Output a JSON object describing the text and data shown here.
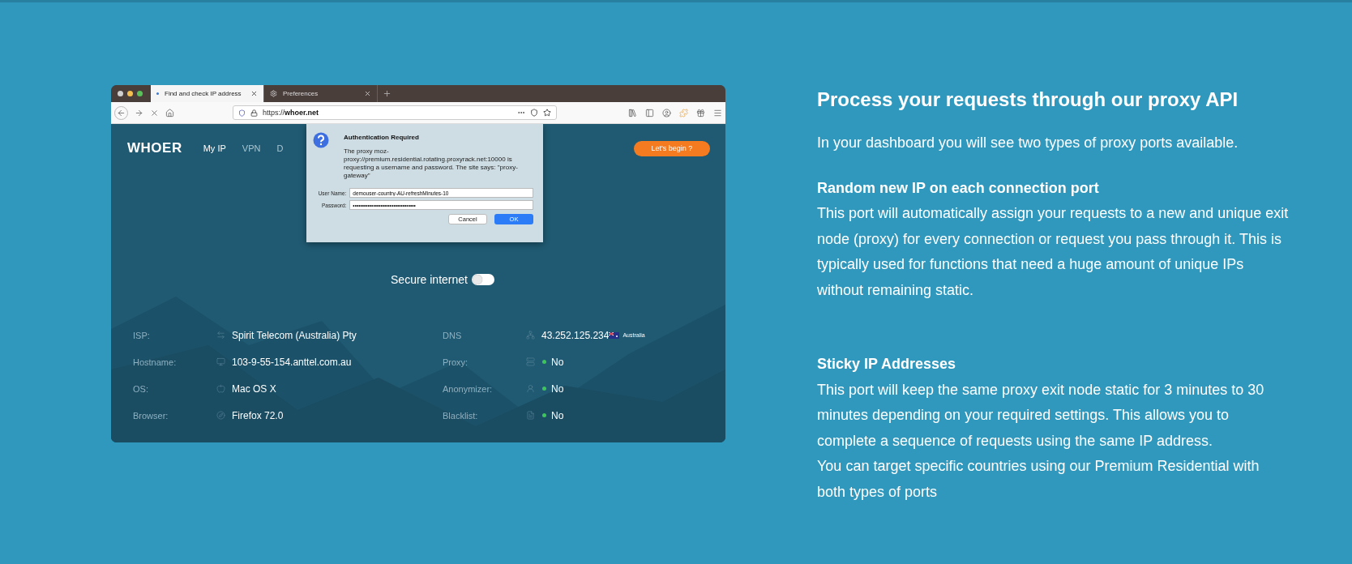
{
  "browser": {
    "tabs": [
      {
        "label": "Find and check IP address",
        "selected": true,
        "kind": "page"
      },
      {
        "label": "Preferences",
        "selected": false,
        "kind": "settings"
      }
    ],
    "address": "https://**whoer.net**",
    "site": {
      "logo": "WHOER",
      "nav": [
        {
          "label": "My IP",
          "selected": true
        },
        {
          "label": "VPN",
          "selected": false
        },
        {
          "label": "D",
          "selected": false
        }
      ],
      "cta": "Let's begin ?",
      "toggle": {
        "label": "Secure internet",
        "on": false
      },
      "info_left": [
        {
          "label": "ISP:",
          "value": "Spirit Telecom (Australia) Pty",
          "kind": "isp"
        },
        {
          "label": "Hostname:",
          "value": "103-9-55-154.anttel.com.au",
          "kind": "host"
        },
        {
          "label": "OS:",
          "value": "Mac OS X",
          "kind": "os"
        },
        {
          "label": "Browser:",
          "value": "Firefox 72.0",
          "kind": "browser"
        }
      ],
      "info_right": [
        {
          "label": "DNS",
          "value": "43.252.125.234",
          "kind": "dns",
          "country": "Australia"
        },
        {
          "label": "Proxy:",
          "value": "No",
          "kind": "proxy",
          "color": "#3fc35c"
        },
        {
          "label": "Anonymizer:",
          "value": "No",
          "kind": "anon",
          "color": "#3fc35c"
        },
        {
          "label": "Blacklist:",
          "value": "No",
          "kind": "blacklist",
          "color": "#3fc35c"
        }
      ]
    },
    "dialog": {
      "title": "Authentication Required",
      "message": "The proxy moz-proxy://premium.residential.rotating.proxyrack.net:10000 is requesting a username and password. The site says: \"proxy-gateway\"",
      "fields": [
        {
          "label": "User Name:",
          "value": "demouser-country-AU-refreshMinutes-10"
        },
        {
          "label": "Password:",
          "value": "••••••••••••••••••••••••••••••••••"
        }
      ],
      "buttons": [
        {
          "label": "Cancel",
          "primary": false
        },
        {
          "label": "OK",
          "primary": true
        }
      ]
    }
  },
  "article": {
    "heading": "Process your requests through our proxy API",
    "intro": "In your dashboard you will see two types of proxy ports available.",
    "sections": [
      {
        "heading": "Random new IP on each connection port",
        "paragraphs": [
          "This port will automatically assign your requests to a new and unique exit node (proxy) for every connection or request you pass through it. This is typically used for functions that need a huge amount of unique IPs without remaining static."
        ]
      },
      {
        "heading": "Sticky IP Addresses",
        "paragraphs": [
          "This port will keep the same proxy exit node static for 3 minutes to 30 minutes depending on your required settings. This allows you to complete a sequence of requests using the same IP address.",
          "You can target specific countries using our Premium Residential with both types of ports"
        ]
      }
    ]
  }
}
